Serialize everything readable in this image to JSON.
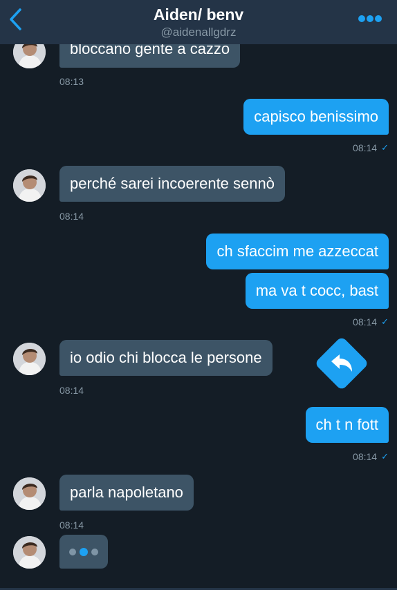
{
  "header": {
    "title": "Aiden/ benv",
    "handle": "@aidenallgdrz"
  },
  "messages": [
    {
      "side": "in",
      "text": "bloccano gente a cazzo",
      "time": "08:13"
    },
    {
      "side": "out",
      "text": "capisco benissimo",
      "time": "08:14"
    },
    {
      "side": "in",
      "text": "perché sarei incoerente sennò",
      "time": "08:14"
    },
    {
      "side": "out",
      "text": "ch sfaccim me azzeccat"
    },
    {
      "side": "out",
      "text": "ma va t cocc, bast",
      "time": "08:14"
    },
    {
      "side": "in",
      "text": "io odio chi blocca le persone",
      "time": "08:14"
    },
    {
      "side": "out",
      "text": "ch t n fott",
      "time": "08:14"
    },
    {
      "side": "in",
      "text": "parla napoletano",
      "time": "08:14"
    }
  ],
  "colors": {
    "background": "#141d26",
    "header": "#243447",
    "incoming_bubble": "#3d5466",
    "outgoing_bubble": "#1da1f2",
    "timestamp": "#8899a6",
    "accent": "#1da1f2"
  },
  "icons": {
    "back": "chevron-left-icon",
    "more": "more-dots-icon",
    "read_receipt": "check-icon",
    "reply": "reply-arrow-icon",
    "typing": "typing-dots-icon"
  },
  "read_receipt_glyph": "✓"
}
